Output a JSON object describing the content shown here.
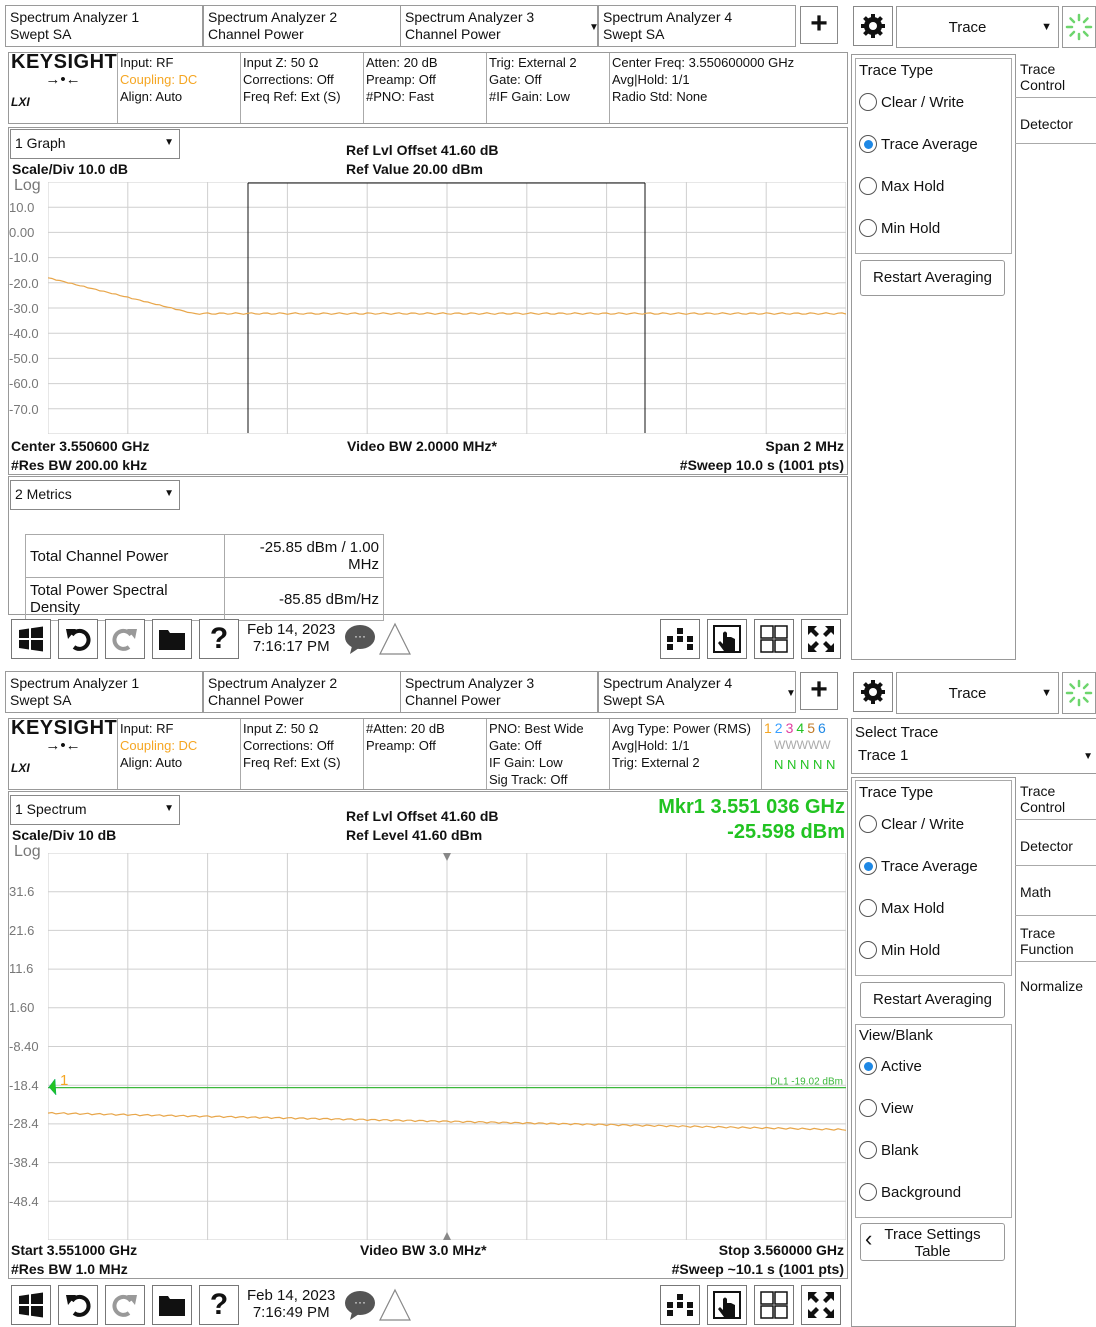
{
  "colors": {
    "trace": "#e8a64a",
    "marker": "#22c322",
    "accent": "#1e88e5",
    "brand_yellow": "#f5a623"
  },
  "top": {
    "tabs": [
      {
        "line1": "Spectrum Analyzer 1",
        "line2": "Swept SA"
      },
      {
        "line1": "Spectrum Analyzer 2",
        "line2": "Channel Power"
      },
      {
        "line1": "Spectrum Analyzer 3",
        "line2": "Channel Power"
      },
      {
        "line1": "Spectrum Analyzer 4",
        "line2": "Swept SA"
      }
    ],
    "menu": "Trace",
    "info": {
      "brand": "KEYSIGHT",
      "lxi": "LXI",
      "c1": [
        "Input: RF",
        "Coupling: DC",
        "Align: Auto"
      ],
      "c2": [
        "Input Z: 50 Ω",
        "Corrections: Off",
        "Freq Ref: Ext (S)"
      ],
      "c3": [
        "Atten: 20 dB",
        "Preamp: Off",
        "#PNO: Fast"
      ],
      "c4": [
        "Trig: External 2",
        "Gate: Off",
        "#IF Gain: Low"
      ],
      "c5": [
        "Center Freq: 3.550600000 GHz",
        "Avg|Hold: 1/1",
        "Radio Std: None"
      ]
    },
    "graph_select": "1 Graph",
    "ref_offset": "Ref Lvl Offset 41.60 dB",
    "ref_value": "Ref Value 20.00 dBm",
    "scale": "Scale/Div 10.0 dB",
    "log": "Log",
    "yticks": [
      "10.0",
      "0.00",
      "-10.0",
      "-20.0",
      "-30.0",
      "-40.0",
      "-50.0",
      "-60.0",
      "-70.0"
    ],
    "center": "Center 3.550600 GHz",
    "vbw": "Video BW 2.0000 MHz*",
    "span": "Span 2 MHz",
    "rbw": "#Res BW 200.00 kHz",
    "sweep": "#Sweep 10.0 s (1001 pts)",
    "metrics_select": "2 Metrics",
    "metrics": [
      {
        "label": "Total Channel Power",
        "value": "-25.85 dBm / 1.00 MHz"
      },
      {
        "label": "Total Power Spectral Density",
        "value": "-85.85 dBm/Hz"
      }
    ],
    "date": "Feb 14, 2023",
    "time": "7:16:17 PM",
    "trace_type_title": "Trace Type",
    "trace_types": [
      "Clear / Write",
      "Trace Average",
      "Max Hold",
      "Min Hold"
    ],
    "restart": "Restart Averaging",
    "side": [
      "Trace Control",
      "Detector"
    ]
  },
  "bottom": {
    "tabs": [
      {
        "line1": "Spectrum Analyzer 1",
        "line2": "Swept SA"
      },
      {
        "line1": "Spectrum Analyzer 2",
        "line2": "Channel Power"
      },
      {
        "line1": "Spectrum Analyzer 3",
        "line2": "Channel Power"
      },
      {
        "line1": "Spectrum Analyzer 4",
        "line2": "Swept SA"
      }
    ],
    "menu": "Trace",
    "info": {
      "brand": "KEYSIGHT",
      "lxi": "LXI",
      "c1": [
        "Input: RF",
        "Coupling: DC",
        "Align: Auto"
      ],
      "c2": [
        "Input Z: 50 Ω",
        "Corrections: Off",
        "Freq Ref: Ext (S)"
      ],
      "c3": [
        "#Atten: 20 dB",
        "Preamp: Off"
      ],
      "c4": [
        "PNO: Best Wide",
        "Gate: Off",
        "IF Gain: Low",
        "Sig Track: Off"
      ],
      "c5": [
        "Avg Type: Power (RMS)",
        "Avg|Hold: 1/1",
        "Trig: External 2"
      ],
      "trace_nums": [
        "1",
        "2",
        "3",
        "4",
        "5",
        "6"
      ],
      "trace_types": "WWWWW",
      "trace_dets": "N N N N N"
    },
    "graph_select": "1 Spectrum",
    "ref_offset": "Ref Lvl Offset 41.60 dB",
    "ref_level": "Ref Level 41.60 dBm",
    "marker_freq": "Mkr1  3.551 036 GHz",
    "marker_amp": "-25.598 dBm",
    "scale": "Scale/Div 10 dB",
    "log": "Log",
    "yticks": [
      "31.6",
      "21.6",
      "11.6",
      "1.60",
      "-8.40",
      "-18.4",
      "-28.4",
      "-38.4",
      "-48.4"
    ],
    "dl_label": "DL1 -19.02 dBm",
    "marker_num": "1",
    "start": "Start 3.551000 GHz",
    "vbw": "Video BW 3.0 MHz*",
    "stop": "Stop 3.560000 GHz",
    "rbw": "#Res BW 1.0 MHz",
    "sweep": "#Sweep ~10.1 s (1001 pts)",
    "date": "Feb 14, 2023",
    "time": "7:16:49 PM",
    "select_trace_title": "Select Trace",
    "select_trace_value": "Trace 1",
    "trace_type_title": "Trace Type",
    "trace_types": [
      "Clear / Write",
      "Trace Average",
      "Max Hold",
      "Min Hold"
    ],
    "restart": "Restart Averaging",
    "view_title": "View/Blank",
    "view_opts": [
      "Active",
      "View",
      "Blank",
      "Background"
    ],
    "settings_table": [
      "Trace Settings",
      "Table"
    ],
    "side": [
      "Trace Control",
      "Detector",
      "Math",
      "Trace Function",
      "Normalize"
    ]
  }
}
